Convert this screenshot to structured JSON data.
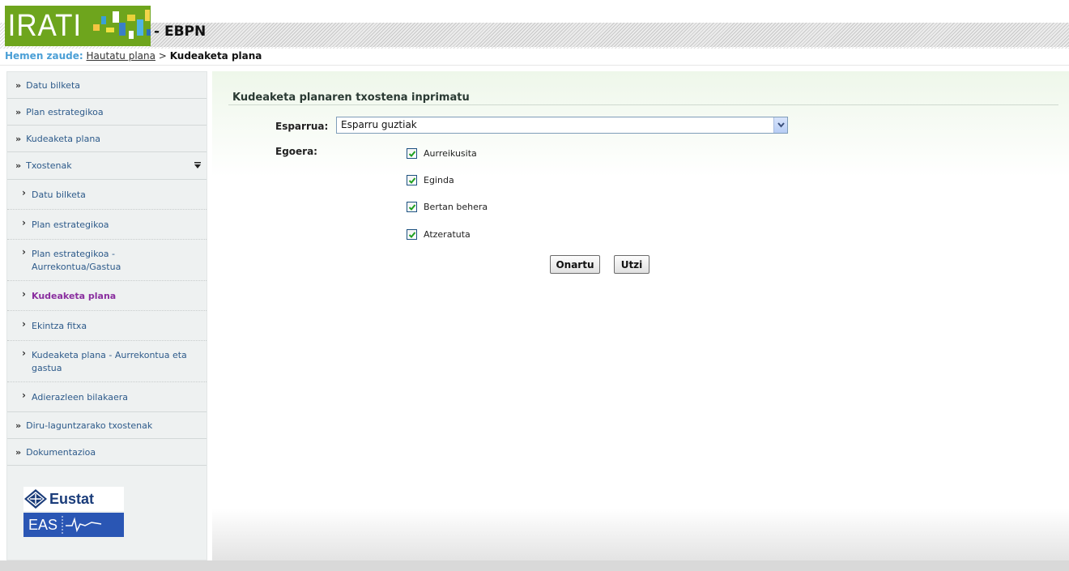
{
  "header": {
    "logo_text": "IRATI",
    "app_suffix": "- EBPN"
  },
  "breadcrumb": {
    "prefix": "Hemen zaude:",
    "link": "Hautatu plana",
    "separator": ">",
    "current": "Kudeaketa plana"
  },
  "sidebar": {
    "items": [
      {
        "label": "Datu bilketa"
      },
      {
        "label": "Plan estrategikoa"
      },
      {
        "label": "Kudeaketa plana"
      },
      {
        "label": "Txostenak"
      }
    ],
    "subitems": [
      {
        "label": "Datu bilketa"
      },
      {
        "label": "Plan estrategikoa"
      },
      {
        "label": "Plan estrategikoa - Aurrekontua/Gastua"
      },
      {
        "label": "Kudeaketa plana"
      },
      {
        "label": "Ekintza fitxa"
      },
      {
        "label": "Kudeaketa plana - Aurrekontua eta gastua"
      },
      {
        "label": "Adierazleen bilakaera"
      }
    ],
    "bottom_items": [
      {
        "label": "Diru-laguntzarako txostenak"
      },
      {
        "label": "Dokumentazioa"
      }
    ],
    "logo_eustat": "Eustat",
    "logo_eas": "EAS"
  },
  "main": {
    "title": "Kudeaketa planaren txostena inprimatu",
    "esparrua_label": "Esparrua:",
    "esparrua_value": "Esparru guztiak",
    "egoera_label": "Egoera:",
    "checkboxes": [
      {
        "label": "Aurreikusita",
        "checked": true
      },
      {
        "label": "Eginda",
        "checked": true
      },
      {
        "label": "Bertan behera",
        "checked": true
      },
      {
        "label": "Atzeratuta",
        "checked": true
      }
    ],
    "ok_button": "Onartu",
    "cancel_button": "Utzi"
  },
  "colors": {
    "accent": "#4a9fd6",
    "active": "#8a2f9f",
    "logo_green": "#6ea51d"
  }
}
